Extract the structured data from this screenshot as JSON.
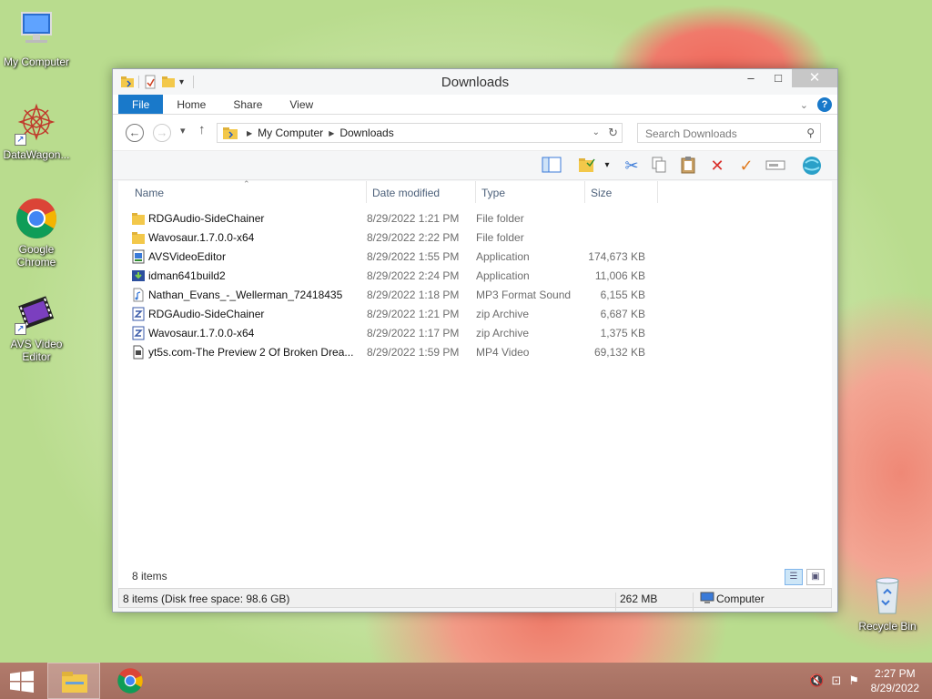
{
  "desktop": {
    "icons": [
      {
        "label": "My Computer",
        "icon": "computer-icon"
      },
      {
        "label": "DataWagon...",
        "icon": "datawagon-icon"
      },
      {
        "label": "Google Chrome",
        "icon": "chrome-icon"
      },
      {
        "label": "AVS Video Editor",
        "icon": "avs-video-editor-icon"
      },
      {
        "label": "Recycle Bin",
        "icon": "recycle-bin-icon"
      }
    ]
  },
  "window": {
    "title": "Downloads",
    "controls": {
      "minimize": "–",
      "maximize": "□",
      "close": "✕"
    },
    "ribbon_tabs": [
      "File",
      "Home",
      "Share",
      "View"
    ],
    "address": {
      "crumbs": [
        "My Computer",
        "Downloads"
      ]
    },
    "search": {
      "placeholder": "Search Downloads"
    },
    "columns": {
      "name": "Name",
      "date": "Date modified",
      "type": "Type",
      "size": "Size"
    },
    "files": [
      {
        "name": "RDGAudio-SideChainer",
        "date": "8/29/2022 1:21 PM",
        "type": "File folder",
        "size": "",
        "icon": "folder-icon"
      },
      {
        "name": "Wavosaur.1.7.0.0-x64",
        "date": "8/29/2022 2:22 PM",
        "type": "File folder",
        "size": "",
        "icon": "folder-icon"
      },
      {
        "name": "AVSVideoEditor",
        "date": "8/29/2022 1:55 PM",
        "type": "Application",
        "size": "174,673 KB",
        "icon": "installer-icon"
      },
      {
        "name": "idman641build2",
        "date": "8/29/2022 2:24 PM",
        "type": "Application",
        "size": "11,006 KB",
        "icon": "idm-icon"
      },
      {
        "name": "Nathan_Evans_-_Wellerman_72418435",
        "date": "8/29/2022 1:18 PM",
        "type": "MP3 Format Sound",
        "size": "6,155 KB",
        "icon": "audio-file-icon"
      },
      {
        "name": "RDGAudio-SideChainer",
        "date": "8/29/2022 1:21 PM",
        "type": "zip Archive",
        "size": "6,687 KB",
        "icon": "zip-icon"
      },
      {
        "name": "Wavosaur.1.7.0.0-x64",
        "date": "8/29/2022 1:17 PM",
        "type": "zip Archive",
        "size": "1,375 KB",
        "icon": "zip-icon"
      },
      {
        "name": "yt5s.com-The Preview 2 Of Broken Drea...",
        "date": "8/29/2022 1:59 PM",
        "type": "MP4 Video",
        "size": "69,132 KB",
        "icon": "video-file-icon"
      }
    ],
    "items_count": "8 items",
    "status": {
      "left": "8 items (Disk free space: 98.6 GB)",
      "size": "262 MB",
      "location": "Computer"
    }
  },
  "taskbar": {
    "clock_time": "2:27 PM",
    "clock_date": "8/29/2022"
  },
  "colors": {
    "accent": "#1979ca",
    "taskbar": "#a97264"
  }
}
